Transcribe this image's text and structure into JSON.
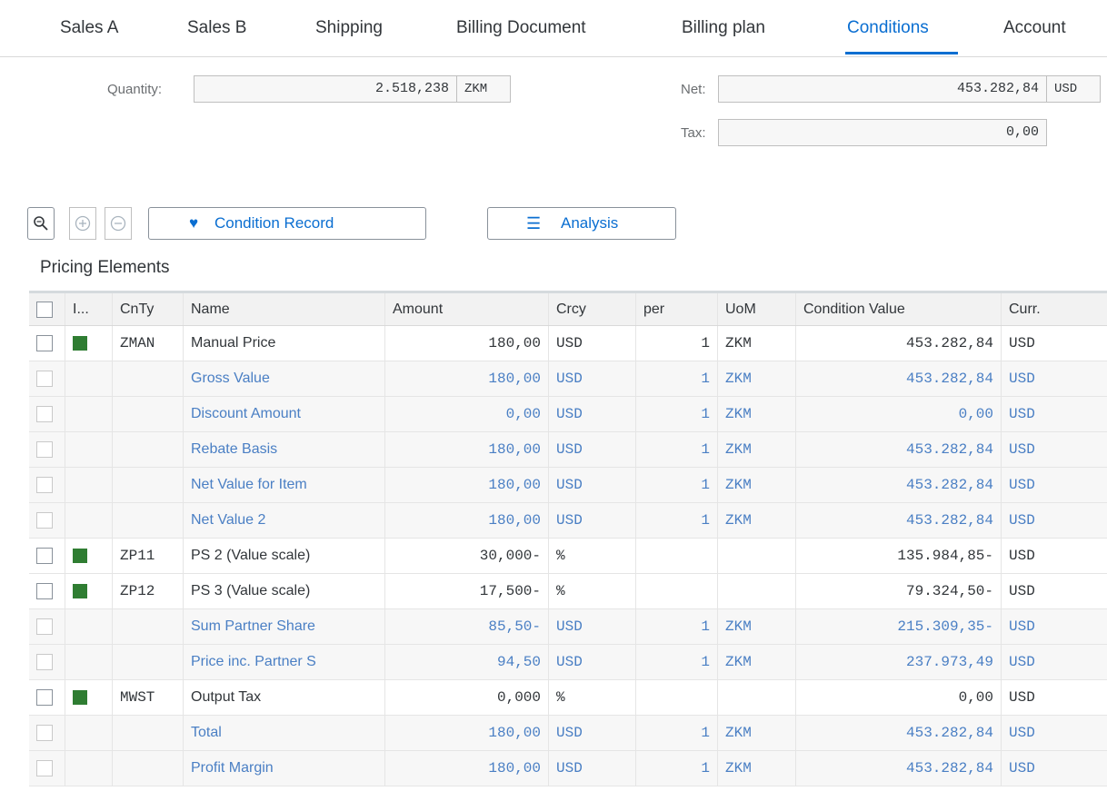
{
  "tabs": [
    {
      "label": "Sales A"
    },
    {
      "label": "Sales B"
    },
    {
      "label": "Shipping"
    },
    {
      "label": "Billing Document"
    },
    {
      "label": "Billing plan"
    },
    {
      "label": "Conditions",
      "active": true
    },
    {
      "label": "Account"
    }
  ],
  "header": {
    "quantity_label": "Quantity:",
    "quantity_value": "2.518,238",
    "quantity_unit": "ZKM",
    "net_label": "Net:",
    "net_value": "453.282,84",
    "net_currency": "USD",
    "tax_label": "Tax:",
    "tax_value": "0,00"
  },
  "toolbar": {
    "condition_record_label": "Condition Record",
    "analysis_label": "Analysis"
  },
  "section_title": "Pricing Elements",
  "table": {
    "columns": [
      "I...",
      "CnTy",
      "Name",
      "Amount",
      "Crcy",
      "per",
      "UoM",
      "Condition Value",
      "Curr."
    ],
    "rows": [
      {
        "inactive": true,
        "cnty": "ZMAN",
        "name": "Manual Price",
        "amount": "180,00",
        "crcy": "USD",
        "per": "1",
        "uom": "ZKM",
        "cond_value": "453.282,84",
        "curr": "USD"
      },
      {
        "inactive": false,
        "cnty": "",
        "name": "Gross Value",
        "amount": "180,00",
        "crcy": "USD",
        "per": "1",
        "uom": "ZKM",
        "cond_value": "453.282,84",
        "curr": "USD"
      },
      {
        "inactive": false,
        "cnty": "",
        "name": "Discount Amount",
        "amount": "0,00",
        "crcy": "USD",
        "per": "1",
        "uom": "ZKM",
        "cond_value": "0,00",
        "curr": "USD"
      },
      {
        "inactive": false,
        "cnty": "",
        "name": "Rebate Basis",
        "amount": "180,00",
        "crcy": "USD",
        "per": "1",
        "uom": "ZKM",
        "cond_value": "453.282,84",
        "curr": "USD"
      },
      {
        "inactive": false,
        "cnty": "",
        "name": "Net Value for Item",
        "amount": "180,00",
        "crcy": "USD",
        "per": "1",
        "uom": "ZKM",
        "cond_value": "453.282,84",
        "curr": "USD"
      },
      {
        "inactive": false,
        "cnty": "",
        "name": "Net Value 2",
        "amount": "180,00",
        "crcy": "USD",
        "per": "1",
        "uom": "ZKM",
        "cond_value": "453.282,84",
        "curr": "USD"
      },
      {
        "inactive": true,
        "cnty": "ZP11",
        "name": "PS 2 (Value scale)",
        "amount": "30,000-",
        "crcy": "%",
        "per": "",
        "uom": "",
        "cond_value": "135.984,85-",
        "curr": "USD"
      },
      {
        "inactive": true,
        "cnty": "ZP12",
        "name": "PS 3 (Value scale)",
        "amount": "17,500-",
        "crcy": "%",
        "per": "",
        "uom": "",
        "cond_value": "79.324,50-",
        "curr": "USD"
      },
      {
        "inactive": false,
        "cnty": "",
        "name": "Sum Partner Share",
        "amount": "85,50-",
        "crcy": "USD",
        "per": "1",
        "uom": "ZKM",
        "cond_value": "215.309,35-",
        "curr": "USD"
      },
      {
        "inactive": false,
        "cnty": "",
        "name": "Price inc. Partner S",
        "amount": "94,50",
        "crcy": "USD",
        "per": "1",
        "uom": "ZKM",
        "cond_value": "237.973,49",
        "curr": "USD"
      },
      {
        "inactive": true,
        "cnty": "MWST",
        "name": "Output Tax",
        "amount": "0,000",
        "crcy": "%",
        "per": "",
        "uom": "",
        "cond_value": "0,00",
        "curr": "USD"
      },
      {
        "inactive": false,
        "cnty": "",
        "name": "Total",
        "amount": "180,00",
        "crcy": "USD",
        "per": "1",
        "uom": "ZKM",
        "cond_value": "453.282,84",
        "curr": "USD"
      },
      {
        "inactive": false,
        "cnty": "",
        "name": "Profit Margin",
        "amount": "180,00",
        "crcy": "USD",
        "per": "1",
        "uom": "ZKM",
        "cond_value": "453.282,84",
        "curr": "USD"
      }
    ]
  },
  "colors": {
    "accent": "#0a6ed1",
    "status_green": "#2f7d32",
    "link_text": "#4a7fc4"
  }
}
